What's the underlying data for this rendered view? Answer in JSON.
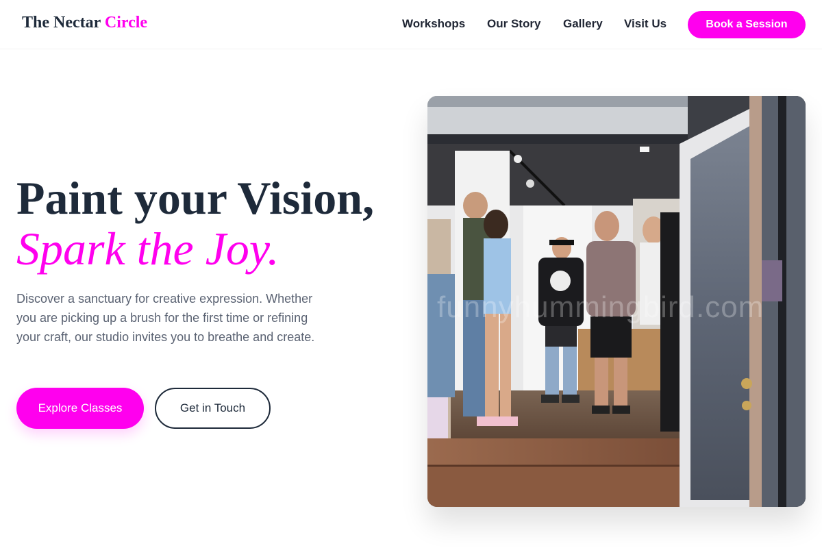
{
  "brand": {
    "name_part1": "The Nectar",
    "name_part2": "Circle"
  },
  "nav": {
    "items": [
      {
        "label": "Workshops"
      },
      {
        "label": "Our Story"
      },
      {
        "label": "Gallery"
      },
      {
        "label": "Visit Us"
      }
    ],
    "cta_label": "Book a Session"
  },
  "hero": {
    "headline": "Paint your Vision,",
    "headline_accent": "Spark the Joy.",
    "description": "Discover a sanctuary for creative expression. Whether you are picking up a brush for the first time or refining your craft, our studio invites you to breathe and create.",
    "primary_button": "Explore Classes",
    "secondary_button": "Get in Touch",
    "image_watermark": "funnyhummingbird.com"
  },
  "colors": {
    "accent": "#ff00ee",
    "heading": "#1e2a3a",
    "body_text": "#5a6272",
    "background": "#ffffff"
  },
  "icons": []
}
